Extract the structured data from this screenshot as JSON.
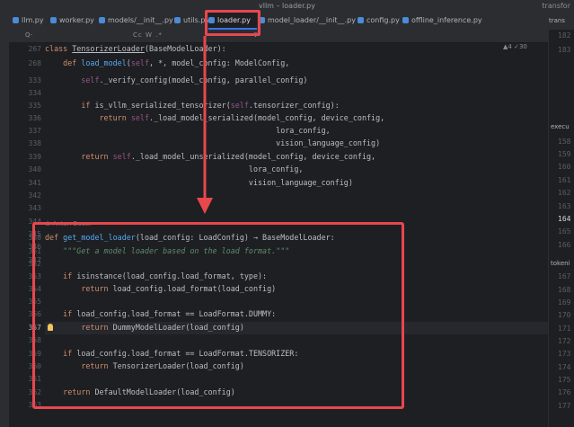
{
  "window": {
    "title": "vllm – loader.py",
    "right_label": "transfor"
  },
  "tabs": [
    {
      "label": "llm.py"
    },
    {
      "label": "worker.py"
    },
    {
      "label": "models/__init__.py"
    },
    {
      "label": "utils.py"
    },
    {
      "label": "loader.py",
      "active": true
    },
    {
      "label": "model_loader/__init__.py"
    },
    {
      "label": "config.py"
    },
    {
      "label": "offline_inference.py"
    }
  ],
  "search": {
    "prompt": "Q-",
    "options": "Cc W .*",
    "filter_icon": "filter-icon"
  },
  "inspection": {
    "warnings": "▲4",
    "checks": "✓30"
  },
  "gutter_lines": [
    "267",
    "268",
    "333",
    "334",
    "335",
    "336",
    "337",
    "338",
    "339",
    "340",
    "341",
    "342",
    "343",
    "344",
    "345",
    "346",
    "347",
    "348",
    "349",
    "350",
    "351",
    "352",
    "353",
    "354",
    "355",
    "356",
    "357",
    "358",
    "359",
    "360",
    "361",
    "362",
    "363"
  ],
  "code": {
    "l267": {
      "kw": "class ",
      "cls": "TensorizerLoader",
      "rest": "(BaseModelLoader):"
    },
    "l268": {
      "indent": "    ",
      "kw": "def ",
      "fn": "load_model",
      "open": "(",
      "slf": "self",
      "rest": ", *, model_config: ModelConfig,"
    },
    "l333": {
      "indent": "        ",
      "slf": "self",
      "rest": "._verify_config(model_config, parallel_config)"
    },
    "l335": {
      "indent": "        ",
      "kw": "if ",
      "rest1": "is_vllm_serialized_tensorizer(",
      "slf": "self",
      "rest2": ".tensorizer_config):"
    },
    "l336": {
      "indent": "            ",
      "kw": "return ",
      "slf": "self",
      "rest": "._load_model_serialized(model_config, device_config,"
    },
    "l337": "                                                   lora_config,",
    "l338": "                                                   vision_language_config)",
    "l339": {
      "indent": "        ",
      "kw": "return ",
      "slf": "self",
      "rest": "._load_model_unserialized(model_config, device_config,"
    },
    "l340": "                                             lora_config,",
    "l341": "                                             vision_language_config)",
    "hint": "Anton Bauer",
    "l350": {
      "kw": "def ",
      "fn": "get_model_loader",
      "rest": "(load_config: LoadConfig) → BaseModelLoader:"
    },
    "l351": "    \"\"\"Get a model loader based on the load format.\"\"\"",
    "l353": {
      "indent": "    ",
      "kw": "if ",
      "rest": "isinstance(load_config.load_format, type):"
    },
    "l354": {
      "indent": "        ",
      "kw": "return ",
      "rest": "load_config.load_format(load_config)"
    },
    "l356": {
      "indent": "    ",
      "kw": "if ",
      "rest": "load_config.load_format == LoadFormat.DUMMY:"
    },
    "l357": {
      "indent": "        ",
      "kw": "return ",
      "rest": "DummyModelLoader(load_config)"
    },
    "l359": {
      "indent": "    ",
      "kw": "if ",
      "rest": "load_config.load_format == LoadFormat.TENSORIZER:"
    },
    "l360": {
      "indent": "        ",
      "kw": "return ",
      "rest": "TensorizerLoader(load_config)"
    },
    "l362": {
      "indent": "    ",
      "kw": "return ",
      "rest": "DefaultModelLoader(load_config)"
    }
  },
  "right_panel": {
    "tab_label": "trans",
    "labels": [
      "execu",
      "tokeni"
    ],
    "lines": [
      "182",
      "183",
      "158",
      "159",
      "160",
      "161",
      "162",
      "163",
      "164",
      "165",
      "166",
      "167",
      "168",
      "169",
      "170",
      "171",
      "172",
      "173",
      "174",
      "175",
      "176",
      "177"
    ],
    "current_line": "164"
  },
  "colors": {
    "accent": "#3574f0",
    "highlight_box": "#e8474e",
    "keyword": "#cf8e6d",
    "function": "#56a8f5",
    "self": "#94558d",
    "docstring": "#5f8c6a"
  }
}
